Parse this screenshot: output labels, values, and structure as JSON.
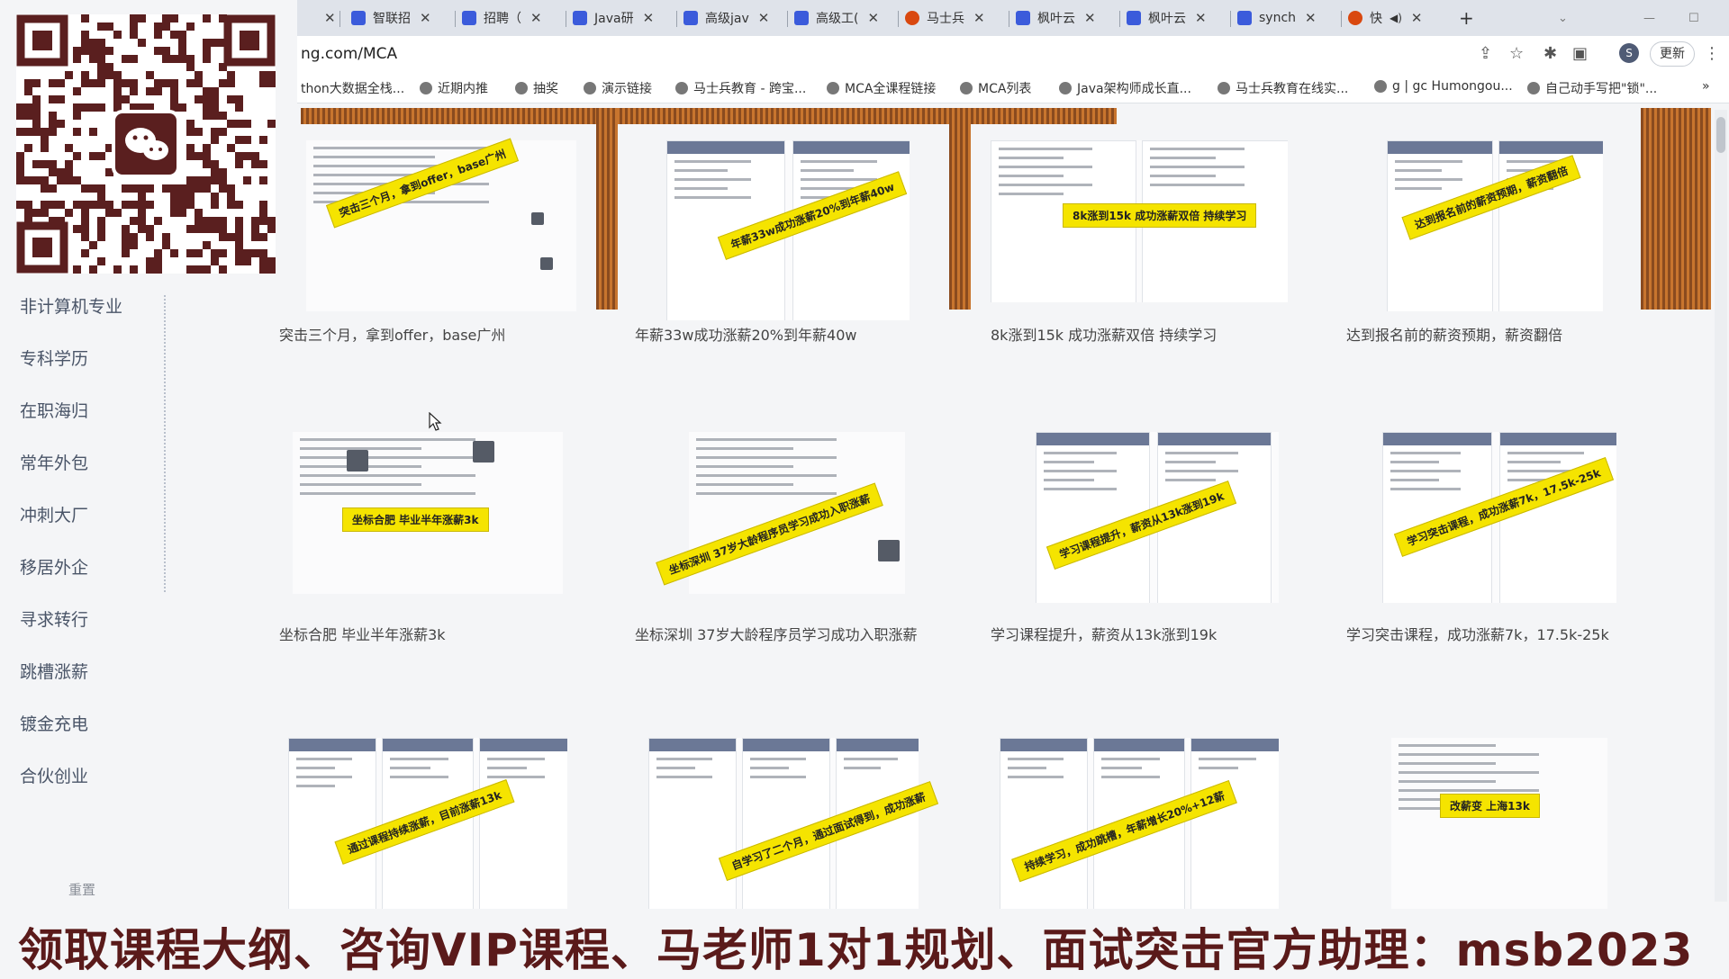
{
  "sidebar": {
    "items": [
      {
        "label": "非计算机专业"
      },
      {
        "label": "专科学历"
      },
      {
        "label": "在职海归"
      },
      {
        "label": "常年外包"
      },
      {
        "label": "冲刺大厂"
      },
      {
        "label": "移居外企"
      },
      {
        "label": "寻求转行"
      },
      {
        "label": "跳槽涨薪"
      },
      {
        "label": "镀金充电"
      },
      {
        "label": "合伙创业"
      }
    ],
    "bottom_mark": "重置"
  },
  "browser": {
    "tabs": [
      {
        "label": "",
        "icon": "close-icon"
      },
      {
        "label": "智联招",
        "color": "#3b5bdb"
      },
      {
        "label": "招聘（",
        "color": "#3b5bdb"
      },
      {
        "label": "Java研",
        "color": "#3b5bdb"
      },
      {
        "label": "高级jav",
        "color": "#3b5bdb"
      },
      {
        "label": "高级工(",
        "color": "#3b5bdb"
      },
      {
        "label": "马士兵",
        "color": "#d9480f"
      },
      {
        "label": "枫叶云",
        "color": "#3b5bdb"
      },
      {
        "label": "枫叶云",
        "color": "#3b5bdb"
      },
      {
        "label": "synch",
        "color": "#3b5bdb"
      },
      {
        "label": "快",
        "color": "#d9480f"
      }
    ],
    "new_tab": "+",
    "url": "ng.com/MCA",
    "avatar_letter": "S",
    "update_label": "更新",
    "bookmarks": [
      {
        "label": "thon大数据全栈..."
      },
      {
        "label": "近期内推"
      },
      {
        "label": "抽奖"
      },
      {
        "label": "演示链接"
      },
      {
        "label": "马士兵教育 - 跨宝..."
      },
      {
        "label": "MCA全课程链接"
      },
      {
        "label": "MCA列表"
      },
      {
        "label": "Java架构师成长直..."
      },
      {
        "label": "马士兵教育在线实..."
      },
      {
        "label": "g | gc Humongou..."
      },
      {
        "label": "自己动手写把\"锁\"..."
      }
    ],
    "more": "»"
  },
  "cards": [
    {
      "caption": "突击三个月，拿到offer，base广州",
      "banner": "突击三个月，拿到offer，base广州"
    },
    {
      "caption": "年薪33w成功涨薪20%到年薪40w",
      "banner": "年薪33w成功涨薪20%到年薪40w"
    },
    {
      "caption": "8k涨到15k 成功涨薪双倍 持续学习",
      "banner": "8k涨到15k 成功涨薪双倍 持续学习"
    },
    {
      "caption": "达到报名前的薪资预期，薪资翻倍",
      "banner": "达到报名前的薪资预期，薪资翻倍"
    },
    {
      "caption": "坐标合肥 毕业半年涨薪3k",
      "banner": "坐标合肥 毕业半年涨薪3k"
    },
    {
      "caption": "坐标深圳 37岁大龄程序员学习成功入职涨薪",
      "banner": "坐标深圳 37岁大龄程序员学习成功入职涨薪"
    },
    {
      "caption": "学习课程提升，薪资从13k涨到19k",
      "banner": "学习课程提升，薪资从13k涨到19k"
    },
    {
      "caption": "学习突击课程，成功涨薪7k，17.5k-25k",
      "banner": "学习突击课程，成功涨薪7k，17.5k-25k"
    },
    {
      "caption": "",
      "banner": "通过课程持续涨薪，目前涨薪13k"
    },
    {
      "caption": "",
      "banner": "自学习了二个月，通过面试得到，成功涨薪"
    },
    {
      "caption": "",
      "banner": "持续学习，成功跳槽，年薪增长20%+12薪"
    },
    {
      "caption": "",
      "banner": "改薪变 上海13k"
    }
  ],
  "footer": {
    "text": "领取课程大纲、咨询VIP课程、马老师1对1规划、面试突击官方助理：msb2023"
  }
}
